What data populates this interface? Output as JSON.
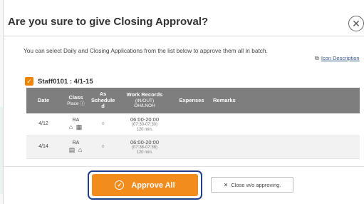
{
  "dialog": {
    "title": "Are you sure to give Closing Approval?",
    "close_glyph": "✕",
    "instructions": "You can select Daily and Closing Applications from the list below to approve them all in batch.",
    "icon_description": "Icon Description"
  },
  "staff": {
    "label": "Staff0101 : 4/1-15",
    "checked": true
  },
  "table": {
    "headers": {
      "date": "Date",
      "class": "Class",
      "place": "Place",
      "as_schedule": "As Schedule d",
      "work_records": "Work Records",
      "work_records_sub1": "(IN/OUT)",
      "work_records_sub2": "OH/LNOH",
      "expenses": "Expenses",
      "remarks": "Remarks"
    },
    "rows": [
      {
        "date": "4/12",
        "class_code": "RA",
        "place_icons": "⌂ ▦",
        "as_scheduled": "○",
        "work_time": "06:00-20:00",
        "break_time": "(07:30-07:30)",
        "duration": "120 min.",
        "expenses": "",
        "remarks": ""
      },
      {
        "date": "4/14",
        "class_code": "RA",
        "place_icons": "▤ ⌂",
        "as_scheduled": "○",
        "work_time": "06:00-20:00",
        "break_time": "(07:38-07:38)",
        "duration": "120 min.",
        "expenses": "",
        "remarks": ""
      }
    ]
  },
  "buttons": {
    "approve_all": "Approve All",
    "close_without": "Close w/o approving."
  },
  "colors": {
    "accent": "#f28c1d",
    "header_bg": "#7e7e7e",
    "highlight_border": "#1f3f8a"
  }
}
